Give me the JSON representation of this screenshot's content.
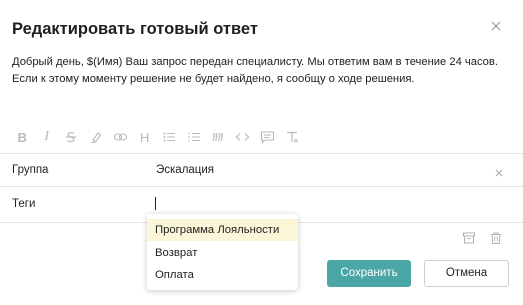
{
  "dialog": {
    "title": "Редактировать готовый ответ",
    "close_icon": "close-icon",
    "message": "Добрый день, $(Имя) Ваш запрос передан специалисту. Мы ответим вам в течение 24 часов. Если к этому моменту решение не будет найдено, я сообщу о ходе решения."
  },
  "toolbar": {
    "icons": [
      "bold-icon",
      "italic-icon",
      "strikethrough-icon",
      "highlight-icon",
      "link-icon",
      "heading-icon",
      "bulleted-list-icon",
      "numbered-list-icon",
      "quote-icon",
      "code-icon",
      "comment-icon",
      "clear-format-icon"
    ],
    "icon_color": "#b9b9b9",
    "labels": {
      "bold": "B",
      "italic": "I",
      "heading": "H"
    }
  },
  "fields": {
    "group": {
      "label": "Группа",
      "value": "Эскалация"
    },
    "tags": {
      "label": "Теги",
      "value": ""
    }
  },
  "tags_dropdown": {
    "options": [
      "Программа Лояльности",
      "Возврат",
      "Оплата"
    ],
    "highlighted": "Программа Лояльности",
    "highlight_color": "#fcf6d8"
  },
  "actions": {
    "save_label": "Сохранить",
    "cancel_label": "Отмена",
    "save_color": "#4aa7a6",
    "archive_icon": "archive-icon",
    "delete_icon": "trash-icon"
  }
}
